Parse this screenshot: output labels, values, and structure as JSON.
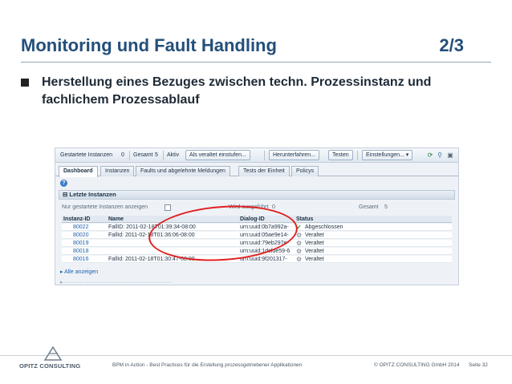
{
  "slide": {
    "title": "Monitoring und Fault Handling",
    "pager": "2/3",
    "bullet": "Herstellung eines Bezuges zwischen techn. Prozessinstanz und fachlichem Prozessablauf"
  },
  "screenshot": {
    "toolbar": {
      "started_label": "Gestartete Instanzen",
      "started_value": "0",
      "total_label": "Gesamt",
      "total_value": "5",
      "active_label": "Aktiv",
      "set_obsolete_button": "Als veraltet einstufen...",
      "shutdown_button": "Herunterfahren...",
      "test_button": "Testen",
      "settings_button": "Einstellungen... ▾"
    },
    "tabs": [
      "Dashboard",
      "Instanzen",
      "Faults und abgelehnte Meldungen",
      "Tests der Einheit",
      "Policys"
    ],
    "panel_title": "Letzte Instanzen",
    "filter": {
      "only_started": "Nur gestartete Instanzen anzeigen",
      "executed_label": "Wird ausgeführt",
      "executed_value": "0",
      "total_label": "Gesamt",
      "total_value": "5"
    },
    "columns": [
      "Instanz-ID",
      "Name",
      "Dialog-ID",
      "Status"
    ],
    "rows": [
      {
        "id": "80022",
        "name": "FallID: 2011-02-18T01:39:34-08:00",
        "dialog": "urn:uuid:0b7a992a-",
        "status": "Abgeschlossen",
        "status_icon": "check-icon"
      },
      {
        "id": "80020",
        "name": "FallId: 2011-02-18T01:36:06-08:00",
        "dialog": "urn:uuid:05ae9e14-",
        "status": "Veraltet",
        "status_icon": "gear-icon"
      },
      {
        "id": "80019",
        "name": "",
        "dialog": "urn:uuid:79eb297e-",
        "status": "Veraltet",
        "status_icon": "gear-icon"
      },
      {
        "id": "80018",
        "name": "",
        "dialog": "urn:uuid:1dcfde59-6",
        "status": "Veraltet",
        "status_icon": "gear-icon"
      },
      {
        "id": "80016",
        "name": "FallId: 2011-02-18T01:30:47-08:00",
        "dialog": "urn:uuid:9f201317-",
        "status": "Veraltet",
        "status_icon": "gear-icon"
      }
    ],
    "show_all": "Alle anzeigen"
  },
  "footer": {
    "logo_text": "OPITZ CONSULTING",
    "description": "BPM in  Action  - Best Practices für die Erstellung prozessgetriebener Applikationen",
    "copyright": "© OPITZ CONSULTING GmbH 2014",
    "page": "Seite 32"
  },
  "colors": {
    "title": "#234f7a",
    "highlight": "#e02020",
    "link": "#1f5fa8"
  }
}
